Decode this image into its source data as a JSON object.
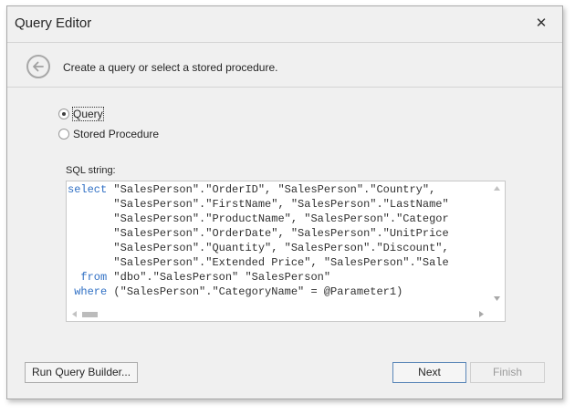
{
  "window": {
    "title": "Query Editor",
    "close_glyph": "✕"
  },
  "header": {
    "back_icon": "arrow-left-circle-icon",
    "instruction": "Create a query or select a stored procedure."
  },
  "options": [
    {
      "label": "Query",
      "checked": true
    },
    {
      "label": "Stored Procedure",
      "checked": false
    }
  ],
  "sql": {
    "label": "SQL string:",
    "lines": [
      {
        "kw": "select",
        "text": " \"SalesPerson\".\"OrderID\", \"SalesPerson\".\"Country\","
      },
      {
        "kw": "      ",
        "text": " \"SalesPerson\".\"FirstName\", \"SalesPerson\".\"LastName\""
      },
      {
        "kw": "      ",
        "text": " \"SalesPerson\".\"ProductName\", \"SalesPerson\".\"Categor"
      },
      {
        "kw": "      ",
        "text": " \"SalesPerson\".\"OrderDate\", \"SalesPerson\".\"UnitPrice"
      },
      {
        "kw": "      ",
        "text": " \"SalesPerson\".\"Quantity\", \"SalesPerson\".\"Discount\","
      },
      {
        "kw": "      ",
        "text": " \"SalesPerson\".\"Extended Price\", \"SalesPerson\".\"Sale"
      },
      {
        "kw": "  from",
        "text": " \"dbo\".\"SalesPerson\" \"SalesPerson\""
      },
      {
        "kw": " where",
        "text": " (\"SalesPerson\".\"CategoryName\" = @Parameter1)"
      }
    ]
  },
  "buttons": {
    "run_query_builder": "Run Query Builder...",
    "next": "Next",
    "finish": "Finish"
  },
  "colors": {
    "keyword": "#2f6fc4",
    "default_button_border": "#5b87b8"
  }
}
